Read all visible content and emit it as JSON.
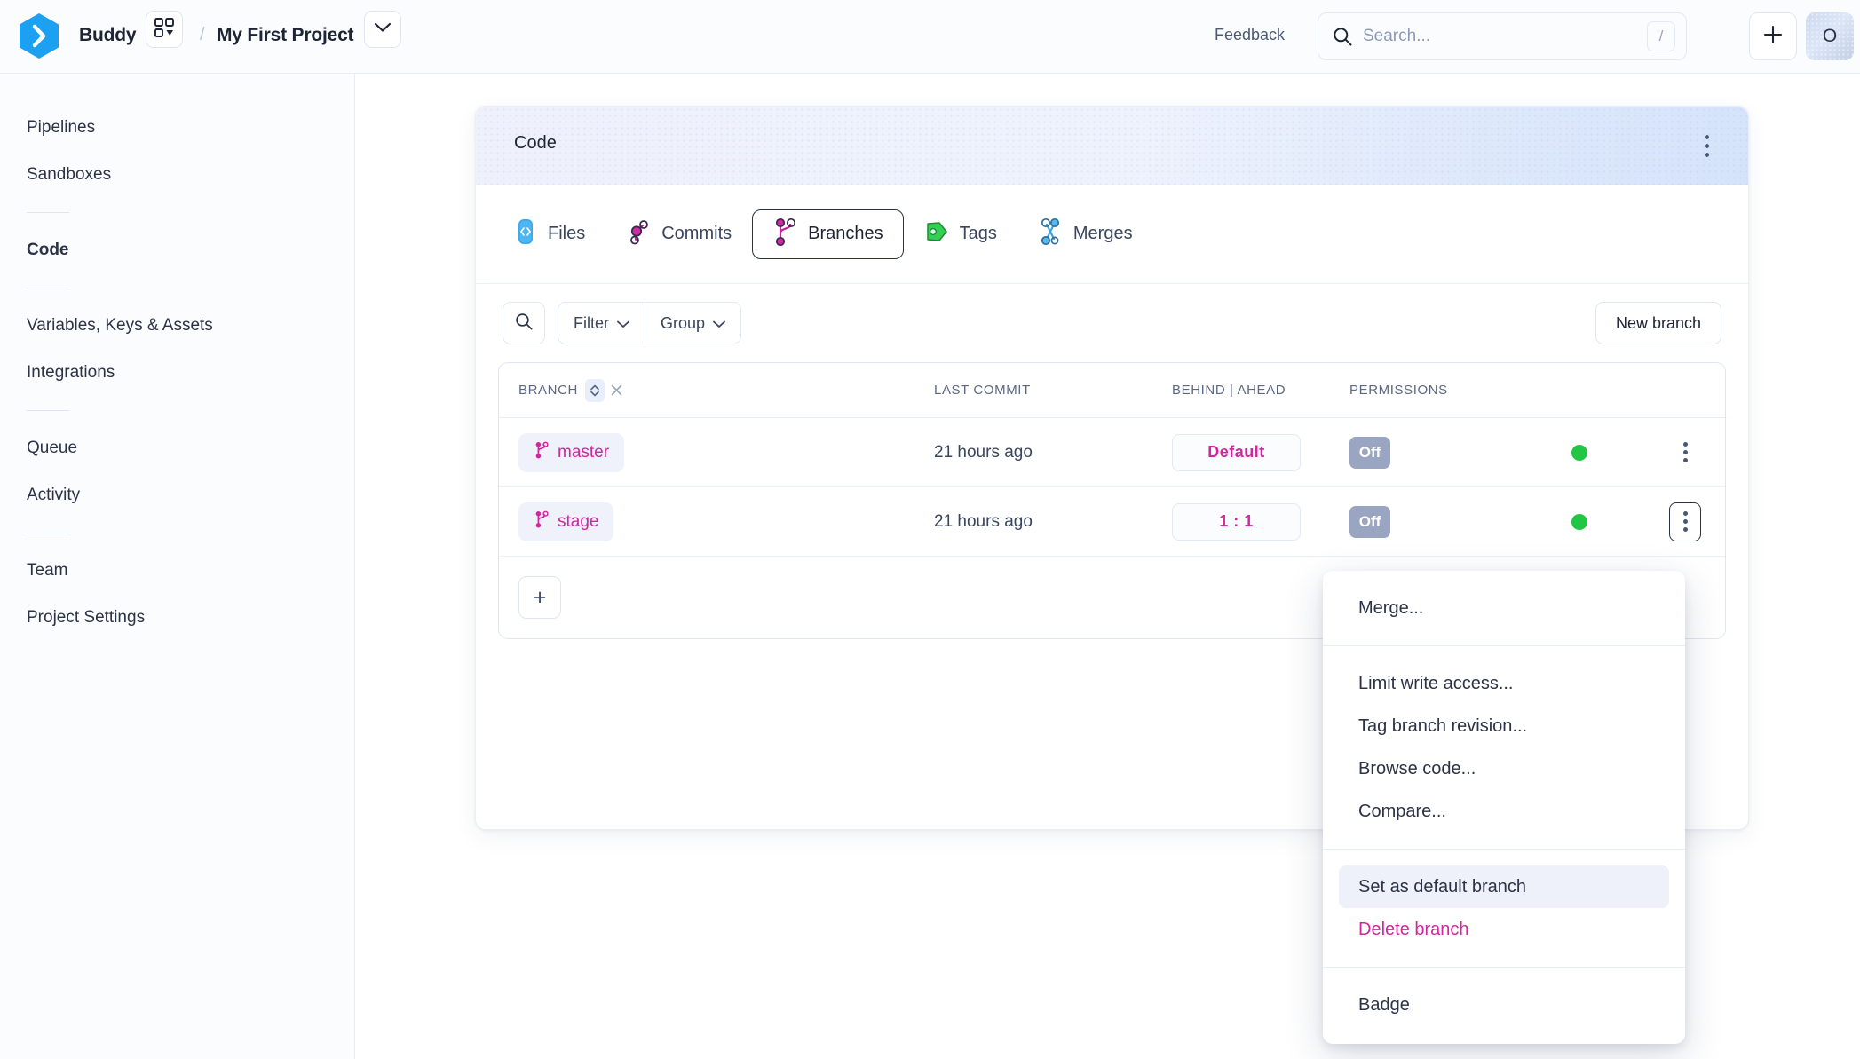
{
  "header": {
    "brand": "Buddy",
    "separator": "/",
    "project": "My First Project",
    "feedback": "Feedback",
    "search_placeholder": "Search...",
    "search_value": "",
    "search_shortcut": "/",
    "plus_label": "+",
    "avatar_initial": "O"
  },
  "sidebar": {
    "groups": [
      {
        "items": [
          {
            "label": "Pipelines",
            "active": false
          },
          {
            "label": "Sandboxes",
            "active": false
          }
        ]
      },
      {
        "items": [
          {
            "label": "Code",
            "active": true
          }
        ]
      },
      {
        "items": [
          {
            "label": "Variables, Keys & Assets",
            "active": false
          },
          {
            "label": "Integrations",
            "active": false
          }
        ]
      },
      {
        "items": [
          {
            "label": "Queue",
            "active": false
          },
          {
            "label": "Activity",
            "active": false
          }
        ]
      },
      {
        "items": [
          {
            "label": "Team",
            "active": false
          },
          {
            "label": "Project Settings",
            "active": false
          }
        ]
      }
    ]
  },
  "panel": {
    "title": "Code",
    "tabs": [
      {
        "label": "Files",
        "icon": "file-code-icon",
        "active": false
      },
      {
        "label": "Commits",
        "icon": "commits-icon",
        "active": false
      },
      {
        "label": "Branches",
        "icon": "branches-icon",
        "active": true
      },
      {
        "label": "Tags",
        "icon": "tag-icon",
        "active": false
      },
      {
        "label": "Merges",
        "icon": "merges-icon",
        "active": false
      }
    ],
    "toolbar": {
      "search_icon": "search-icon",
      "filter_label": "Filter",
      "group_label": "Group",
      "new_branch_label": "New branch"
    },
    "table": {
      "columns": {
        "branch": "BRANCH",
        "last_commit": "LAST COMMIT",
        "behind_ahead": "BEHIND | AHEAD",
        "permissions": "PERMISSIONS"
      },
      "rows": [
        {
          "branch": "master",
          "last_commit": "21 hours ago",
          "behind_ahead": "Default",
          "permission": "Off",
          "status": "green",
          "menu_open": false
        },
        {
          "branch": "stage",
          "last_commit": "21 hours ago",
          "behind_ahead": "1 : 1",
          "permission": "Off",
          "status": "green",
          "menu_open": true
        }
      ],
      "add_label": "+"
    }
  },
  "context_menu": {
    "groups": [
      {
        "items": [
          {
            "label": "Merge...",
            "style": "normal",
            "hovered": false
          }
        ]
      },
      {
        "items": [
          {
            "label": "Limit write access...",
            "style": "normal",
            "hovered": false
          },
          {
            "label": "Tag branch revision...",
            "style": "normal",
            "hovered": false
          },
          {
            "label": "Browse code...",
            "style": "normal",
            "hovered": false
          },
          {
            "label": "Compare...",
            "style": "normal",
            "hovered": false
          }
        ]
      },
      {
        "items": [
          {
            "label": "Set as default branch",
            "style": "normal",
            "hovered": true
          },
          {
            "label": "Delete branch",
            "style": "danger",
            "hovered": false
          }
        ]
      },
      {
        "items": [
          {
            "label": "Badge",
            "style": "normal",
            "hovered": false
          }
        ]
      }
    ]
  },
  "colors": {
    "brand_blue": "#1ba0f2",
    "accent_pink": "#d1269e",
    "status_green": "#22c645",
    "text_dark": "#1d2433",
    "toggle_gray": "#9aa5c2"
  }
}
